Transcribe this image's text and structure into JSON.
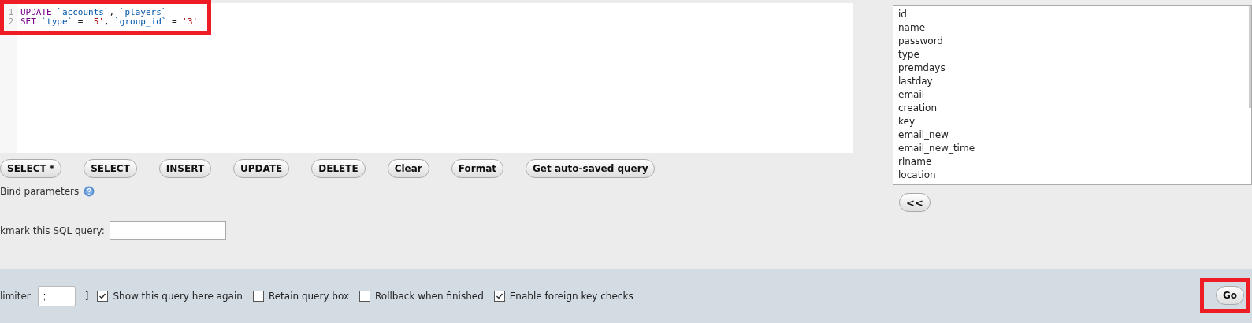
{
  "editor": {
    "highlighted": true,
    "lines": [
      {
        "number": "1",
        "tokens": [
          {
            "kind": "keyword",
            "text": "UPDATE "
          },
          {
            "kind": "identifier",
            "text": "`accounts`"
          },
          {
            "kind": "plain",
            "text": ", "
          },
          {
            "kind": "identifier",
            "text": "`players`"
          }
        ]
      },
      {
        "number": "2",
        "tokens": [
          {
            "kind": "keyword",
            "text": "SET "
          },
          {
            "kind": "identifier",
            "text": "`type`"
          },
          {
            "kind": "plain",
            "text": " = "
          },
          {
            "kind": "string",
            "text": "'5'"
          },
          {
            "kind": "plain",
            "text": ", "
          },
          {
            "kind": "identifier",
            "text": "`group_id`"
          },
          {
            "kind": "plain",
            "text": " = "
          },
          {
            "kind": "string",
            "text": "'3'"
          }
        ]
      }
    ]
  },
  "query_buttons": [
    "SELECT *",
    "SELECT",
    "INSERT",
    "UPDATE",
    "DELETE",
    "Clear",
    "Format",
    "Get auto-saved query"
  ],
  "bind_parameters": {
    "label": "Bind parameters"
  },
  "bookmark": {
    "label": "kmark this SQL query:"
  },
  "columns_list": [
    "id",
    "name",
    "password",
    "type",
    "premdays",
    "lastday",
    "email",
    "creation",
    "key",
    "email_new",
    "email_new_time",
    "rlname",
    "location"
  ],
  "insert_button": "<<",
  "footer": {
    "delimiter_label": "limiter",
    "delimiter_value": ";",
    "bracket": "]",
    "options": [
      {
        "label": "Show this query here again",
        "checked": true
      },
      {
        "label": "Retain query box",
        "checked": false
      },
      {
        "label": "Rollback when finished",
        "checked": false
      },
      {
        "label": "Enable foreign key checks",
        "checked": true
      }
    ],
    "go_button": {
      "label": "Go",
      "highlighted": true
    }
  }
}
